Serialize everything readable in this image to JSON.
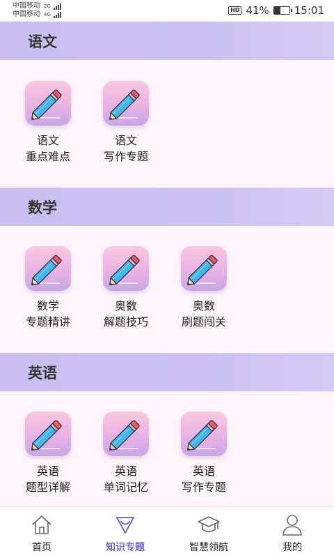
{
  "status_bar": {
    "carrier_1": "中国移动",
    "carrier_2": "中国移动",
    "net_1": "2G",
    "net_2": "4G",
    "hd_badge": "HD",
    "battery_percent": "41%",
    "battery_level": 0.41,
    "time": "15:01"
  },
  "sections": [
    {
      "title": "语文",
      "items": [
        {
          "line1": "语文",
          "line2": "重点难点"
        },
        {
          "line1": "语文",
          "line2": "写作专题"
        }
      ]
    },
    {
      "title": "数学",
      "items": [
        {
          "line1": "数学",
          "line2": "专题精讲"
        },
        {
          "line1": "奥数",
          "line2": "解题技巧"
        },
        {
          "line1": "奥数",
          "line2": "刷题闯关"
        }
      ]
    },
    {
      "title": "英语",
      "items": [
        {
          "line1": "英语",
          "line2": "题型详解"
        },
        {
          "line1": "英语",
          "line2": "单词记忆"
        },
        {
          "line1": "英语",
          "line2": "写作专题"
        }
      ]
    }
  ],
  "bottom_nav": [
    {
      "label": "首页",
      "icon": "home-icon",
      "active": false
    },
    {
      "label": "知识专题",
      "icon": "knowledge-icon",
      "active": true
    },
    {
      "label": "智慧领航",
      "icon": "graduation-cap-icon",
      "active": false
    },
    {
      "label": "我的",
      "icon": "user-icon",
      "active": false
    }
  ],
  "colors": {
    "header_bg": "#c9bff0",
    "active_nav": "#7b66c9",
    "page_bg": "#fdf5f9"
  }
}
